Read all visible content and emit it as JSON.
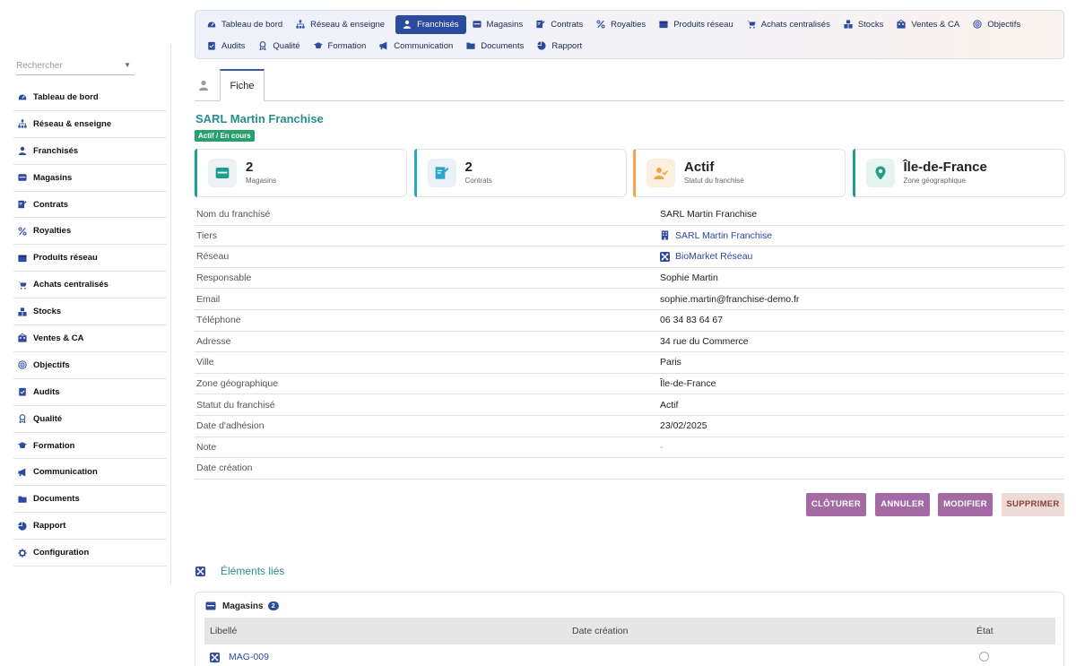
{
  "colors": {
    "accent": "#2c4a9e",
    "teal": "#2a8e8e",
    "success": "#27a06b",
    "action": "#a46aa6",
    "danger_bg": "#eddcd6"
  },
  "sidebar": {
    "search_placeholder": "Rechercher",
    "items": [
      {
        "label": "Tableau de bord",
        "icon": "dashboard-icon"
      },
      {
        "label": "Réseau & enseigne",
        "icon": "network-icon"
      },
      {
        "label": "Franchisés",
        "icon": "user-icon"
      },
      {
        "label": "Magasins",
        "icon": "store-icon"
      },
      {
        "label": "Contrats",
        "icon": "contract-icon"
      },
      {
        "label": "Royalties",
        "icon": "percent-icon"
      },
      {
        "label": "Produits réseau",
        "icon": "box-icon"
      },
      {
        "label": "Achats centralisés",
        "icon": "cart-icon"
      },
      {
        "label": "Stocks",
        "icon": "stock-icon"
      },
      {
        "label": "Ventes & CA",
        "icon": "sales-icon"
      },
      {
        "label": "Objectifs",
        "icon": "target-icon"
      },
      {
        "label": "Audits",
        "icon": "clipboard-icon"
      },
      {
        "label": "Qualité",
        "icon": "award-icon"
      },
      {
        "label": "Formation",
        "icon": "graduation-icon"
      },
      {
        "label": "Communication",
        "icon": "megaphone-icon"
      },
      {
        "label": "Documents",
        "icon": "folder-icon"
      },
      {
        "label": "Rapport",
        "icon": "chart-icon"
      },
      {
        "label": "Configuration",
        "icon": "gear-icon"
      }
    ]
  },
  "topnav": {
    "row1": [
      {
        "label": "Tableau de bord",
        "icon": "dashboard-icon"
      },
      {
        "label": "Réseau & enseigne",
        "icon": "network-icon"
      },
      {
        "label": "Franchisés",
        "icon": "user-icon",
        "active": true
      },
      {
        "label": "Magasins",
        "icon": "store-icon"
      },
      {
        "label": "Contrats",
        "icon": "contract-icon"
      },
      {
        "label": "Royalties",
        "icon": "percent-icon"
      },
      {
        "label": "Produits réseau",
        "icon": "box-icon"
      },
      {
        "label": "Achats centralisés",
        "icon": "cart-icon"
      },
      {
        "label": "Stocks",
        "icon": "stock-icon"
      },
      {
        "label": "Ventes & CA",
        "icon": "sales-icon"
      },
      {
        "label": "Objectifs",
        "icon": "target-icon"
      }
    ],
    "row2": [
      {
        "label": "Audits",
        "icon": "clipboard-icon"
      },
      {
        "label": "Qualité",
        "icon": "award-icon"
      },
      {
        "label": "Formation",
        "icon": "graduation-icon"
      },
      {
        "label": "Communication",
        "icon": "megaphone-icon"
      },
      {
        "label": "Documents",
        "icon": "folder-icon"
      },
      {
        "label": "Rapport",
        "icon": "chart-icon"
      }
    ]
  },
  "subtabs": {
    "fiche": "Fiche"
  },
  "record": {
    "title": "SARL Martin Franchise",
    "badge": "Actif / En cours"
  },
  "cards": [
    {
      "value": "2",
      "label": "Magasins",
      "icon": "store-icon",
      "color": "#1f9e8e",
      "bg": "#eef1f4"
    },
    {
      "value": "2",
      "label": "Contrats",
      "icon": "contract-icon",
      "color": "#2aa6c9",
      "bg": "#eaf2f8"
    },
    {
      "value": "Actif",
      "label": "Statut du franchisé",
      "icon": "user-check-icon",
      "color": "#f0a646",
      "bg": "#fbefe0"
    },
    {
      "value": "Île-de-France",
      "label": "Zone géographique",
      "icon": "map-pin-icon",
      "color": "#1f9e8e",
      "bg": "#e5f4ef"
    }
  ],
  "fields": [
    {
      "key": "Nom du franchisé",
      "value": "SARL Martin Franchise"
    },
    {
      "key": "Tiers",
      "value": "SARL Martin Franchise",
      "link": true,
      "icon": "building-icon"
    },
    {
      "key": "Réseau",
      "value": "BioMarket Réseau",
      "link": true,
      "icon": "network-link-icon"
    },
    {
      "key": "Responsable",
      "value": "Sophie Martin"
    },
    {
      "key": "Email",
      "value": "sophie.martin@franchise-demo.fr"
    },
    {
      "key": "Téléphone",
      "value": "06 34 83 64 67"
    },
    {
      "key": "Adresse",
      "value": "34 rue du Commerce"
    },
    {
      "key": "Ville",
      "value": "Paris"
    },
    {
      "key": "Zone géographique",
      "value": "Île-de-France"
    },
    {
      "key": "Statut du franchisé",
      "value": "Actif"
    },
    {
      "key": "Date d'adhésion",
      "value": "23/02/2025"
    },
    {
      "key": "Note",
      "value": "-",
      "muted": true
    },
    {
      "key": "Date création",
      "value": ""
    }
  ],
  "actions": {
    "cloturer": "CLÔTURER",
    "annuler": "ANNULER",
    "modifier": "MODIFIER",
    "supprimer": "SUPPRIMER"
  },
  "linked": {
    "title": "Éléments liés",
    "panel_title": "Magasins",
    "count": "2",
    "columns": [
      "Libellé",
      "Date création",
      "État"
    ],
    "rows": [
      {
        "ref": "MAG-009"
      }
    ]
  }
}
